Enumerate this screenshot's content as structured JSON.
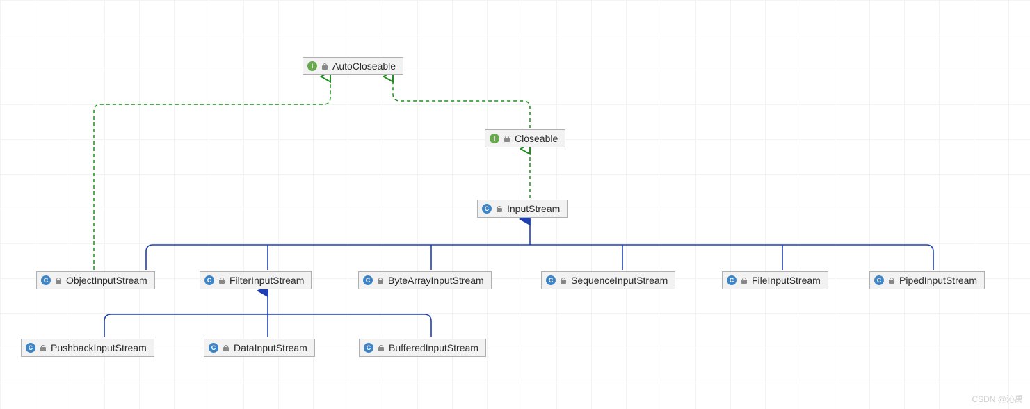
{
  "diagram": {
    "colors": {
      "interface_badge": "#6aa84f",
      "class_badge": "#3d85c6",
      "implements_line": "#1a8f1a",
      "extends_line": "#1f3fb3",
      "node_fill": "#f2f2f2",
      "node_border": "#b0b0b0"
    },
    "badge_letters": {
      "interface": "I",
      "class": "C"
    },
    "nodes": {
      "autoCloseable": {
        "label": "AutoCloseable",
        "kind": "interface"
      },
      "closeable": {
        "label": "Closeable",
        "kind": "interface"
      },
      "inputStream": {
        "label": "InputStream",
        "kind": "class"
      },
      "objectIS": {
        "label": "ObjectInputStream",
        "kind": "class"
      },
      "filterIS": {
        "label": "FilterInputStream",
        "kind": "class"
      },
      "byteArrayIS": {
        "label": "ByteArrayInputStream",
        "kind": "class"
      },
      "sequenceIS": {
        "label": "SequenceInputStream",
        "kind": "class"
      },
      "fileIS": {
        "label": "FileInputStream",
        "kind": "class"
      },
      "pipedIS": {
        "label": "PipedInputStream",
        "kind": "class"
      },
      "pushbackIS": {
        "label": "PushbackInputStream",
        "kind": "class"
      },
      "dataIS": {
        "label": "DataInputStream",
        "kind": "class"
      },
      "bufferedIS": {
        "label": "BufferedInputStream",
        "kind": "class"
      }
    },
    "edges": [
      {
        "from": "closeable",
        "to": "autoCloseable",
        "type": "implements"
      },
      {
        "from": "inputStream",
        "to": "closeable",
        "type": "implements"
      },
      {
        "from": "objectIS",
        "to": "autoCloseable",
        "type": "implements"
      },
      {
        "from": "objectIS",
        "to": "inputStream",
        "type": "extends"
      },
      {
        "from": "filterIS",
        "to": "inputStream",
        "type": "extends"
      },
      {
        "from": "byteArrayIS",
        "to": "inputStream",
        "type": "extends"
      },
      {
        "from": "sequenceIS",
        "to": "inputStream",
        "type": "extends"
      },
      {
        "from": "fileIS",
        "to": "inputStream",
        "type": "extends"
      },
      {
        "from": "pipedIS",
        "to": "inputStream",
        "type": "extends"
      },
      {
        "from": "pushbackIS",
        "to": "filterIS",
        "type": "extends"
      },
      {
        "from": "dataIS",
        "to": "filterIS",
        "type": "extends"
      },
      {
        "from": "bufferedIS",
        "to": "filterIS",
        "type": "extends"
      }
    ]
  },
  "watermark": "CSDN @沁禹"
}
